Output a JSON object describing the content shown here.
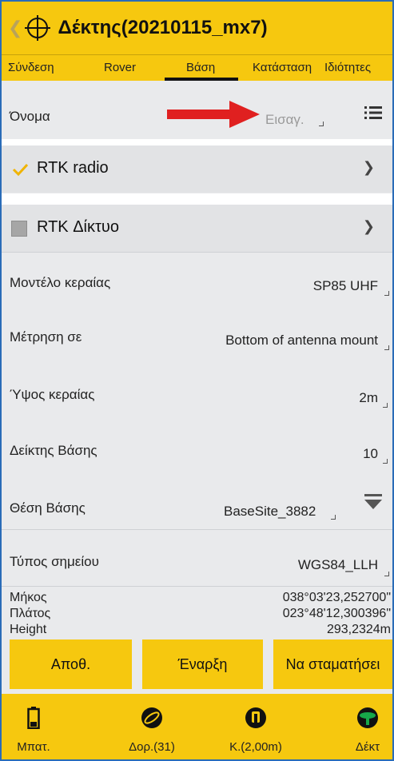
{
  "header": {
    "title": "Δέκτης(20210115_mx7)"
  },
  "tabs": [
    "Σύνδεση",
    "Rover",
    "Βάση",
    "Κατάσταση",
    "Ιδιότητες"
  ],
  "name_row": {
    "label": "Όνομα",
    "placeholder": "Εισαγ."
  },
  "rtk_radio": {
    "label": "RTK radio",
    "checked": true
  },
  "rtk_network": {
    "label": "RTK Δίκτυο",
    "checked": false
  },
  "fields": {
    "antenna_model": {
      "label": "Μοντέλο κεραίας",
      "value": "SP85 UHF"
    },
    "measure_to": {
      "label": "Μέτρηση σε",
      "value": "Bottom of antenna mount"
    },
    "antenna_height": {
      "label": "Ύψος κεραίας",
      "value": "2m"
    },
    "base_index": {
      "label": "Δείκτης Βάσης",
      "value": "10"
    },
    "base_position": {
      "label": "Θέση Βάσης",
      "value": "BaseSite_3882"
    },
    "point_type": {
      "label": "Τύπος σημείου",
      "value": "WGS84_LLH"
    }
  },
  "coords": {
    "longitude": {
      "label": "Μήκος",
      "value": "038°03'23,252700\""
    },
    "latitude": {
      "label": "Πλάτος",
      "value": "023°48'12,300396\""
    },
    "height": {
      "label": "Height",
      "value": "293,2324m"
    }
  },
  "buttons": {
    "save": "Αποθ.",
    "start": "Έναρξη",
    "stop": "Να σταματήσει"
  },
  "bottom_nav": {
    "battery": "Μπατ.",
    "satellites": "Δορ.(31)",
    "channel": "Κ.(2,00m)",
    "receiver": "Δέκτ"
  },
  "colors": {
    "accent": "#f6c80f",
    "check": "#f0b400",
    "arrow": "#e02020",
    "receiver_icon": "#17a84a"
  }
}
